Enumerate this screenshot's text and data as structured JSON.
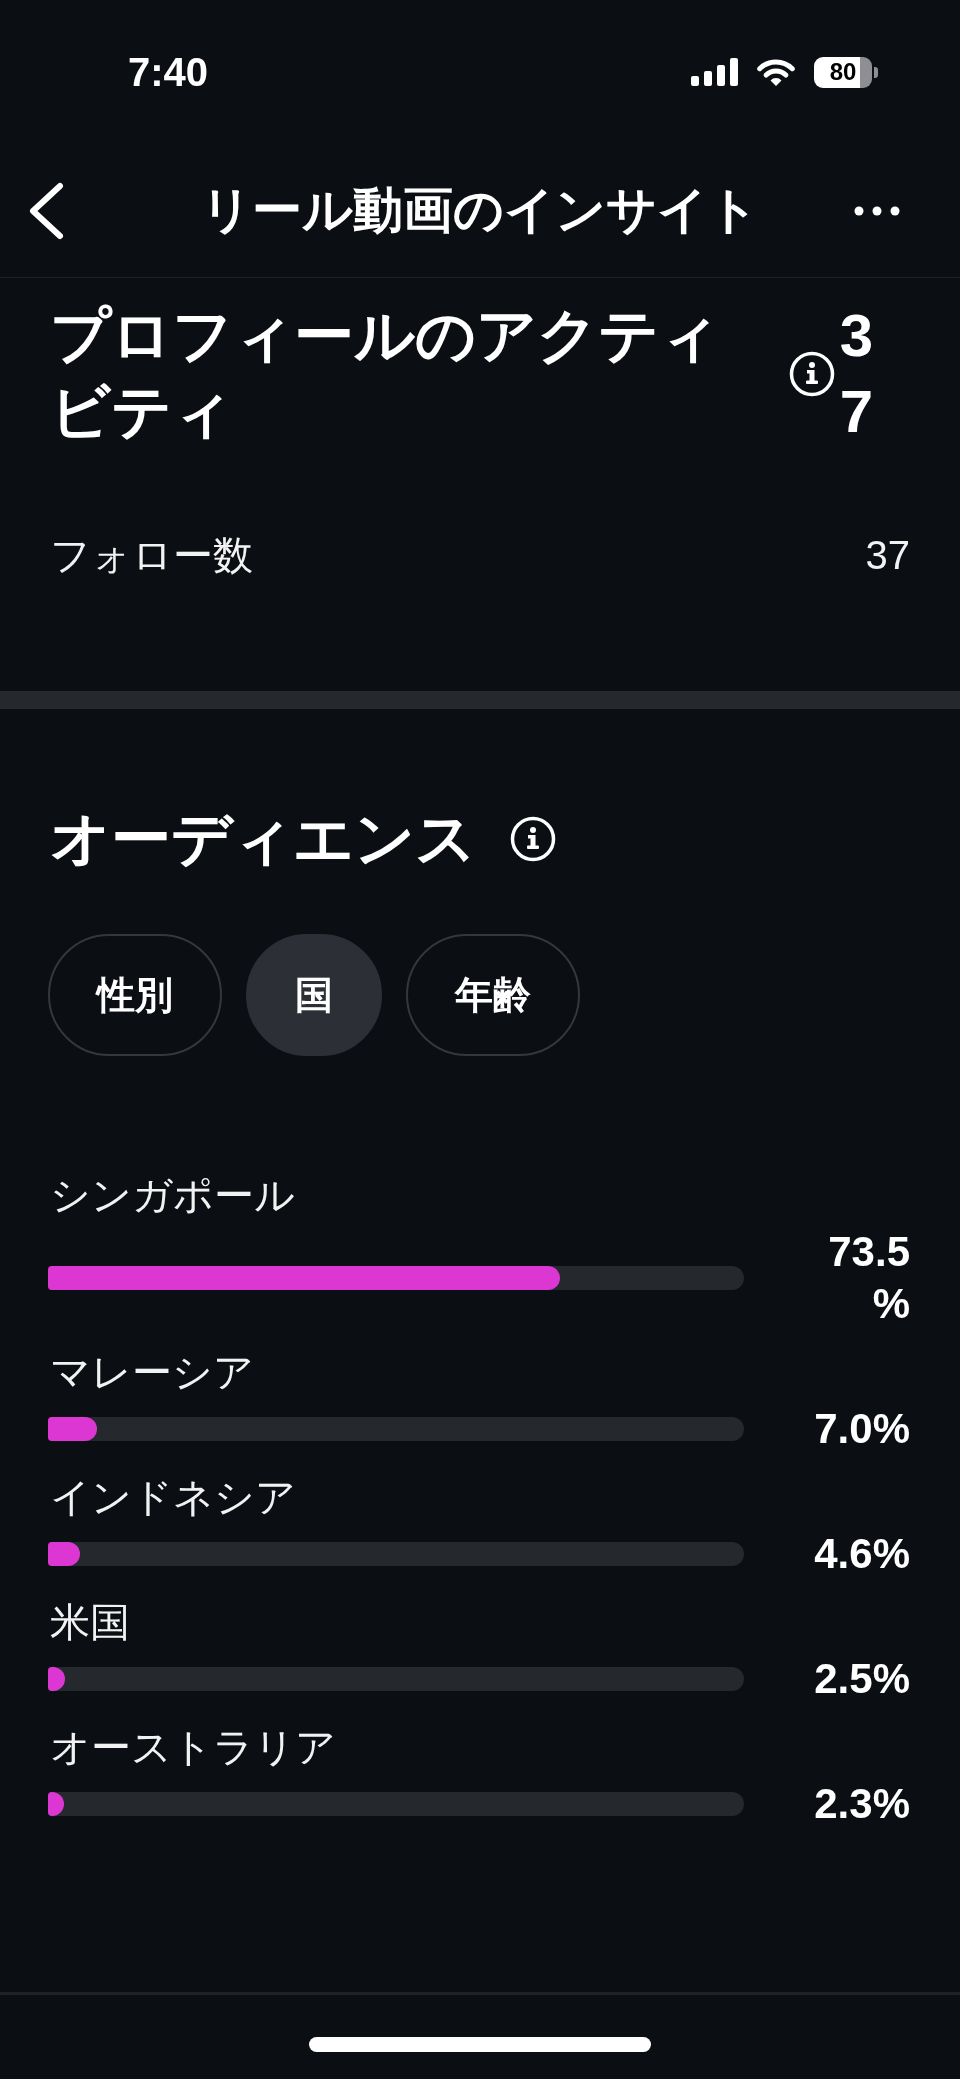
{
  "status_bar": {
    "time": "7:40",
    "battery": "80"
  },
  "header": {
    "title": "リール動画のインサイト"
  },
  "profile_activity": {
    "title": "プロフィールのアクティビティ",
    "value": "37",
    "rows": [
      {
        "label": "フォロー数",
        "value": "37"
      }
    ]
  },
  "audience": {
    "title": "オーディエンス",
    "tabs": [
      {
        "label": "性別",
        "selected": false
      },
      {
        "label": "国",
        "selected": true
      },
      {
        "label": "年齢",
        "selected": false
      }
    ],
    "countries": [
      {
        "name": "シンガポール",
        "level": 0.735,
        "reading": "73.5%"
      },
      {
        "name": "マレーシア",
        "level": 0.07,
        "reading": "7.0%"
      },
      {
        "name": "インドネシア",
        "level": 0.046,
        "reading": "4.6%"
      },
      {
        "name": "米国",
        "level": 0.025,
        "reading": "2.5%"
      },
      {
        "name": "オーストラリア",
        "level": 0.023,
        "reading": "2.3%"
      }
    ]
  }
}
